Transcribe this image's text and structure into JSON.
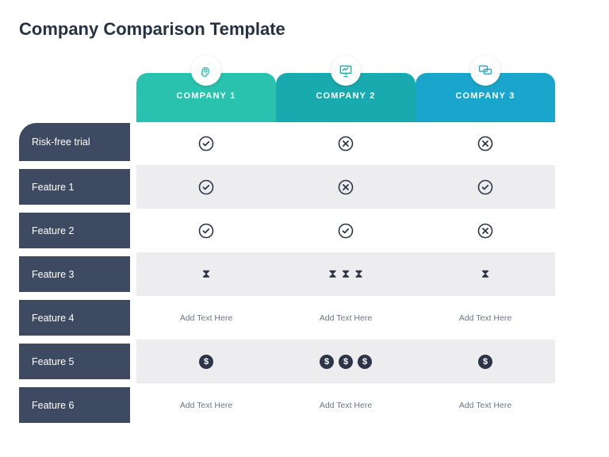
{
  "title": "Company Comparison Template",
  "companies": [
    {
      "label": "COMPANY 1",
      "icon": "head-gear-icon"
    },
    {
      "label": "COMPANY 2",
      "icon": "presentation-icon"
    },
    {
      "label": "COMPANY 3",
      "icon": "chat-icon"
    }
  ],
  "rows": [
    {
      "label": "Risk-free trial",
      "cells": [
        {
          "type": "check"
        },
        {
          "type": "cross"
        },
        {
          "type": "cross"
        }
      ]
    },
    {
      "label": "Feature 1",
      "cells": [
        {
          "type": "check"
        },
        {
          "type": "cross"
        },
        {
          "type": "check"
        }
      ]
    },
    {
      "label": "Feature 2",
      "cells": [
        {
          "type": "check"
        },
        {
          "type": "check"
        },
        {
          "type": "cross"
        }
      ]
    },
    {
      "label": "Feature 3",
      "cells": [
        {
          "type": "hourglass",
          "count": 1
        },
        {
          "type": "hourglass",
          "count": 3
        },
        {
          "type": "hourglass",
          "count": 1
        }
      ]
    },
    {
      "label": "Feature 4",
      "cells": [
        {
          "type": "text",
          "value": "Add Text Here"
        },
        {
          "type": "text",
          "value": "Add Text Here"
        },
        {
          "type": "text",
          "value": "Add Text Here"
        }
      ]
    },
    {
      "label": "Feature 5",
      "cells": [
        {
          "type": "dollar",
          "count": 1
        },
        {
          "type": "dollar",
          "count": 3
        },
        {
          "type": "dollar",
          "count": 1
        }
      ]
    },
    {
      "label": "Feature 6",
      "cells": [
        {
          "type": "text",
          "value": "Add Text Here"
        },
        {
          "type": "text",
          "value": "Add Text Here"
        },
        {
          "type": "text",
          "value": "Add Text Here"
        }
      ]
    }
  ],
  "glyphs": {
    "dollar": "$",
    "hourglass": "⧗"
  },
  "colors": {
    "company1": "#28c2af",
    "company2": "#19aab0",
    "company3": "#1aa6cc",
    "row_label": "#3e4a61",
    "stripe": "#ededf0"
  }
}
